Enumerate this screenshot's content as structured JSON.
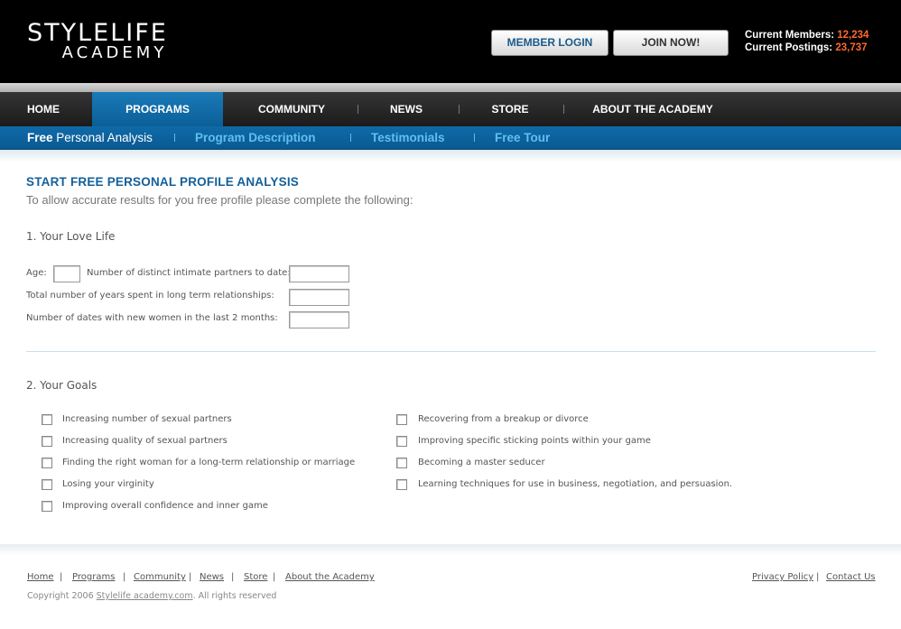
{
  "header": {
    "logo_line1": "STYLELIFE",
    "logo_line2": "ACADEMY",
    "member_login": "MEMBER  LOGIN",
    "join_now": "JOIN NOW!",
    "members_label": "Current Members:",
    "members_value": "12,234",
    "postings_label": "Current Postings:",
    "postings_value": "23,737",
    "accent_color": "#ff6a2a"
  },
  "main_nav": {
    "items": [
      "HOME",
      "PROGRAMS",
      "COMMUNITY",
      "NEWS",
      "STORE",
      "ABOUT THE ACADEMY"
    ],
    "active": "PROGRAMS",
    "active_color": "#0b5f98"
  },
  "sub_nav": {
    "first_bold": "Free",
    "first_rest": "Personal Analysis",
    "items": [
      "Program Description",
      "Testimonials",
      "Free Tour"
    ]
  },
  "content": {
    "title": "START FREE PERSONAL PROFILE ANALYSIS",
    "intro": "To allow accurate results for you free profile please complete the following:",
    "section1": "1. Your Love Life",
    "age_label": "Age:",
    "partners_label": "Number of distinct intimate partners to date:",
    "years_label": "Total number of years spent in long term relationships:",
    "dates_label": "Number of dates with new women in the last 2 months:",
    "section2": "2. Your Goals",
    "goals_left": [
      "Increasing number of sexual partners",
      "Increasing quality of sexual partners",
      "Finding the right woman for a long-term relationship or marriage",
      "Losing your virginity",
      "Improving overall confidence and inner game"
    ],
    "goals_right": [
      "Recovering from a breakup or divorce",
      "Improving specific sticking points within your game",
      "Becoming a master seducer",
      "Learning techniques for use in business, negotiation, and persuasion."
    ]
  },
  "footer": {
    "links": [
      "Home",
      "Programs",
      "Community",
      "News",
      "Store",
      "About the Academy"
    ],
    "right_links": [
      "Privacy Policy",
      "Contact Us"
    ],
    "copyright_prefix": "Copyright 2006",
    "copyright_link": "Stylelife academy.com",
    "copyright_suffix": ".  All rights reserved"
  }
}
